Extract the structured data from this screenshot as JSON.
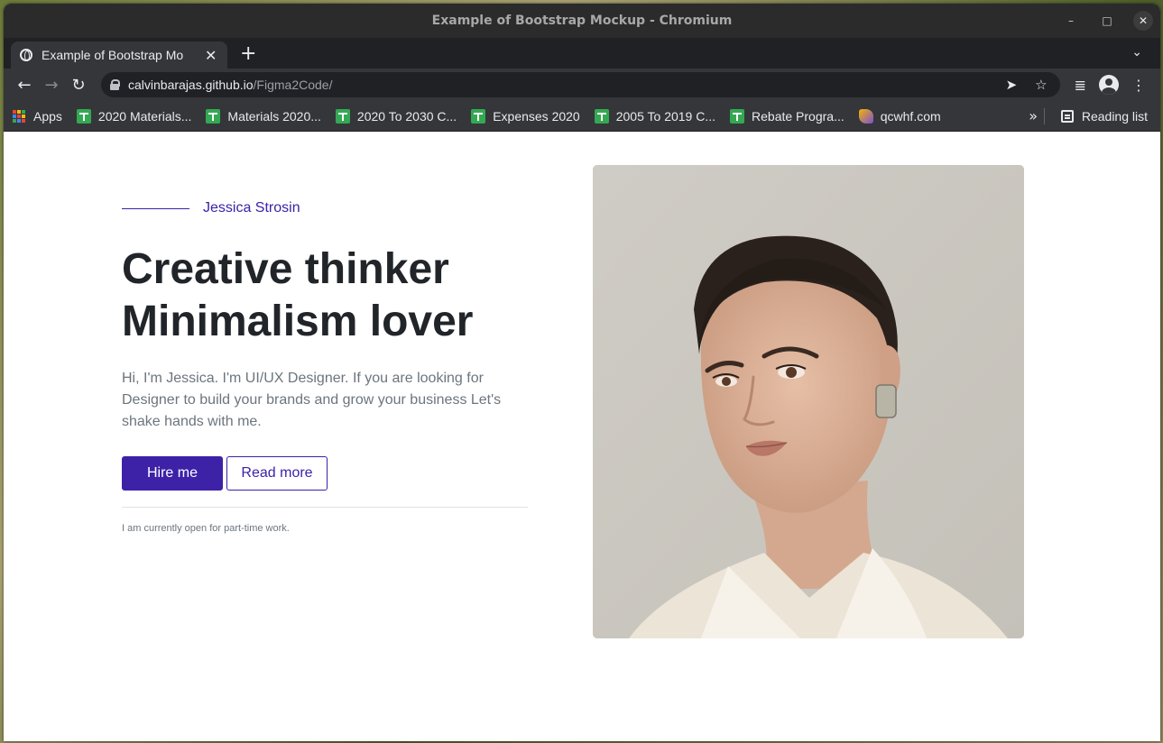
{
  "window": {
    "title": "Example of Bootstrap Mockup - Chromium"
  },
  "tab": {
    "title": "Example of Bootstrap Mo",
    "close_label": "✕",
    "new_tab_label": "+"
  },
  "address": {
    "host": "calvinbarajas.github.io",
    "path": "/Figma2Code/"
  },
  "bookmarks": {
    "apps_label": "Apps",
    "items": [
      {
        "label": "2020 Materials..."
      },
      {
        "label": "Materials 2020..."
      },
      {
        "label": "2020 To 2030 C..."
      },
      {
        "label": "Expenses 2020"
      },
      {
        "label": "2005 To 2019 C..."
      },
      {
        "label": "Rebate Progra..."
      }
    ],
    "site_label": "qcwhf.com",
    "more_label": "»",
    "reading_list_label": "Reading list"
  },
  "hero": {
    "eyebrow_name": "Jessica Strosin",
    "headline_line1": "Creative thinker",
    "headline_line2": "Minimalism lover",
    "intro": "Hi, I'm Jessica. I'm UI/UX Designer. If you are looking for Designer to build your brands and grow your business Let's shake hands with me.",
    "primary_button": "Hire me",
    "secondary_button": "Read more",
    "note": "I am currently open for part-time work."
  },
  "colors": {
    "accent": "#3d22a8",
    "headline": "#212529",
    "muted": "#6c757d",
    "chrome_dark": "#202124",
    "chrome_toolbar": "#35363a"
  },
  "icons": {
    "back": "arrow-left-icon",
    "forward": "arrow-right-icon",
    "reload": "reload-icon",
    "lock": "lock-icon",
    "send": "send-icon",
    "star": "star-icon",
    "media": "media-queue-icon",
    "profile": "profile-icon",
    "menu": "kebab-menu-icon"
  }
}
